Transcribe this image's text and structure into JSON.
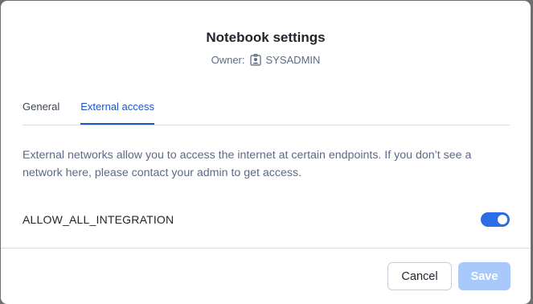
{
  "dialog": {
    "title": "Notebook settings",
    "owner_label": "Owner:",
    "owner_name": "SYSADMIN",
    "owner_icon": "user-badge-icon"
  },
  "tabs": [
    {
      "label": "General",
      "active": false
    },
    {
      "label": "External access",
      "active": true
    }
  ],
  "external_access": {
    "description": "External networks allow you to access the internet at certain endpoints. If you don’t see a network here, please contact your admin to get access.",
    "integrations": [
      {
        "name": "ALLOW_ALL_INTEGRATION",
        "enabled": true
      }
    ]
  },
  "footer": {
    "cancel_label": "Cancel",
    "save_label": "Save",
    "save_disabled": true
  },
  "colors": {
    "accent": "#1a56c4",
    "toggle_on": "#2c6de6",
    "save_disabled_bg": "#a9c8fb",
    "backdrop": "#6f6f6f"
  }
}
